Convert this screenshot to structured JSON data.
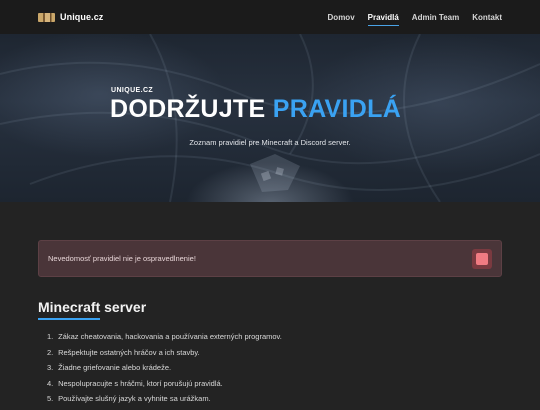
{
  "navbar": {
    "brand_name": "Unique.cz",
    "links": [
      {
        "label": "Domov",
        "active": false
      },
      {
        "label": "Pravidlá",
        "active": true
      },
      {
        "label": "Admin Team",
        "active": false
      },
      {
        "label": "Kontakt",
        "active": false
      }
    ]
  },
  "hero": {
    "small_label": "UNIQUE.CZ",
    "title_white": "DODRŽUJTE",
    "title_blue": "PRAVIDLÁ",
    "subtitle": "Zoznam pravidiel pre Minecraft a Discord server."
  },
  "alert": {
    "text": "Nevedomosť pravidiel nie je ospravedlnenie!"
  },
  "section": {
    "title": "Minecraft server",
    "rules": [
      {
        "num": "1.",
        "text": "Zákaz cheatovania, hackovania a používania externých programov."
      },
      {
        "num": "2.",
        "text": "Rešpektujte ostatných hráčov a ich stavby."
      },
      {
        "num": "3.",
        "text": "Žiadne griefovanie alebo krádeže."
      },
      {
        "num": "4.",
        "text": "Nespolupracujte s hráčmi, ktorí porušujú pravidlá."
      },
      {
        "num": "5.",
        "text": "Používajte slušný jazyk a vyhnite sa urážkam."
      }
    ]
  },
  "colors": {
    "accent": "#3aa2f2",
    "background": "#232323",
    "navbar": "#1b1b1b",
    "alert_bg": "#4a3539",
    "alert_close": "#f07b82"
  }
}
